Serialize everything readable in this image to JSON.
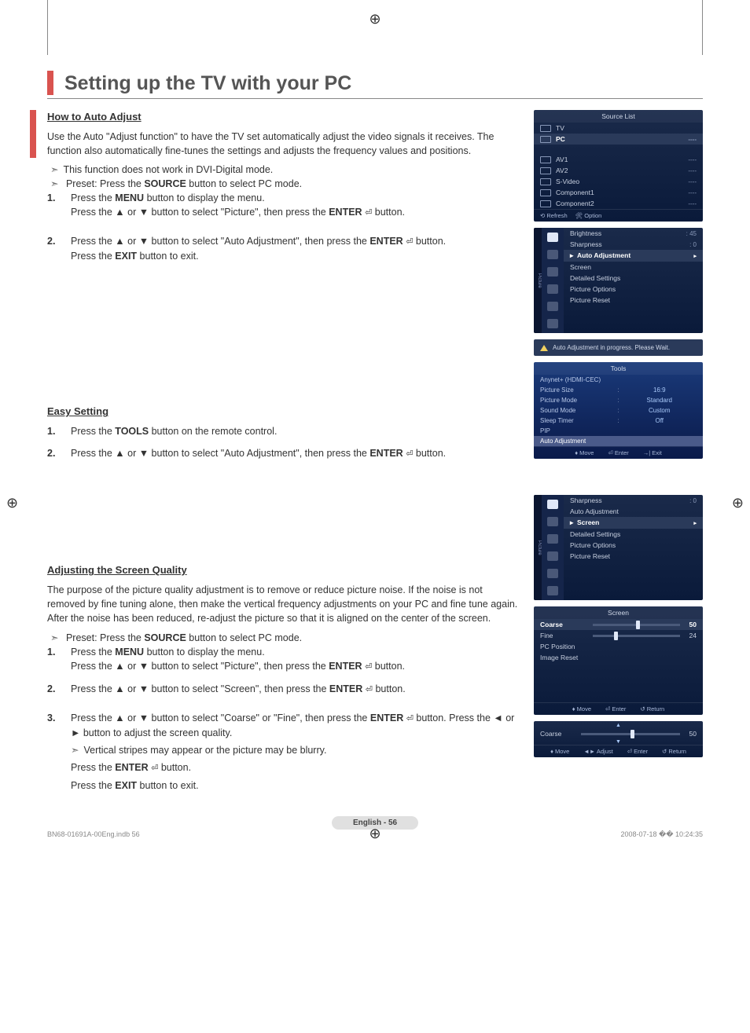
{
  "page": {
    "title": "Setting up the TV with your PC",
    "footer_badge": "English - 56",
    "doc_footer_left": "BN68-01691A-00Eng.indb   56",
    "doc_footer_right": "2008-07-18   �� 10:24:35"
  },
  "section1": {
    "heading": "How to Auto Adjust",
    "intro": "Use the Auto \"Adjust function\" to have the TV set automatically adjust the video signals it receives. The function also automatically fine-tunes the settings and adjusts the frequency values and positions.",
    "note1": "This function does not work in DVI-Digital mode.",
    "note2_pre": "Preset: Press the ",
    "note2_btn": "SOURCE",
    "note2_post": " button to select PC mode.",
    "step1_pre": "Press the ",
    "step1_btn": "MENU",
    "step1_post": " button to display the menu.",
    "step1b": "Press the ▲ or ▼ button to select \"Picture\", then press the ",
    "step1b_btn": "ENTER",
    "step1b_post": " button.",
    "step2": "Press the ▲ or ▼ button to select \"Auto Adjustment\", then press the ",
    "step2_btn": "ENTER",
    "step2_post": " button.",
    "step2_exit_pre": "Press the ",
    "step2_exit_btn": "EXIT",
    "step2_exit_post": " button to exit."
  },
  "section2": {
    "heading": "Easy Setting",
    "step1_pre": "Press the ",
    "step1_btn": "TOOLS",
    "step1_post": " button on the remote control.",
    "step2": "Press the ▲ or ▼ button to select \"Auto Adjustment\", then press the ",
    "step2_btn": "ENTER",
    "step2_post": " button."
  },
  "section3": {
    "heading": "Adjusting the Screen Quality",
    "intro": "The purpose of the picture quality adjustment is to remove or reduce picture noise. If the noise is not removed by fine tuning alone, then make the vertical frequency adjustments on your PC and fine tune again. After the noise has been reduced, re-adjust the picture so that it is aligned on the center of the screen.",
    "note1_pre": "Preset: Press the ",
    "note1_btn": "SOURCE",
    "note1_post": " button to select PC mode.",
    "step1_pre": "Press the ",
    "step1_btn": "MENU",
    "step1_post": " button to display the menu.",
    "step1b": "Press the ▲ or ▼ button to select \"Picture\", then press the ",
    "step1b_btn": "ENTER",
    "step1b_post": " button.",
    "step2": "Press the ▲ or ▼ button to select \"Screen\", then press the ",
    "step2_btn": "ENTER",
    "step2_post": " button.",
    "step3": "Press the ▲ or ▼ button to select \"Coarse\" or \"Fine\", then press the ",
    "step3_btn": "ENTER",
    "step3_post": " button. Press the ◄ or ► button to adjust the screen quality.",
    "step3_note": "Vertical stripes may appear or the picture may be blurry.",
    "step3_enter_pre": "Press the ",
    "step3_enter_btn": "ENTER",
    "step3_enter_post": " button.",
    "step3_exit_pre": "Press the ",
    "step3_exit_btn": "EXIT",
    "step3_exit_post": " button to exit."
  },
  "osd": {
    "source_list": {
      "title": "Source List",
      "items": [
        {
          "label": "TV",
          "value": ""
        },
        {
          "label": "PC",
          "value": "----",
          "selected": true
        },
        {
          "label": "AV1",
          "value": "----"
        },
        {
          "label": "AV2",
          "value": "----"
        },
        {
          "label": "S-Video",
          "value": "----"
        },
        {
          "label": "Component1",
          "value": "----"
        },
        {
          "label": "Component2",
          "value": "----"
        }
      ],
      "footer": [
        {
          "icon": "⟲",
          "label": "Refresh"
        },
        {
          "icon": "🛠",
          "label": "Option"
        }
      ]
    },
    "picture1": {
      "tab": "Picture",
      "top_rows": [
        {
          "label": "Brightness",
          "value": ": 45"
        },
        {
          "label": "Sharpness",
          "value": ": 0"
        }
      ],
      "selected": "Auto Adjustment",
      "rows": [
        "Screen",
        "Detailed Settings",
        "Picture Options",
        "Picture Reset"
      ]
    },
    "info_bar": "Auto Adjustment in progress. Please Wait.",
    "tools": {
      "title": "Tools",
      "top": "Anynet+ (HDMI-CEC)",
      "rows": [
        {
          "l": "Picture Size",
          "v": "16:9"
        },
        {
          "l": "Picture Mode",
          "v": "Standard"
        },
        {
          "l": "Sound Mode",
          "v": "Custom"
        },
        {
          "l": "Sleep Timer",
          "v": "Off"
        },
        {
          "l": "PIP",
          "v": ""
        }
      ],
      "hl": "Auto Adjustment",
      "footer": [
        {
          "i": "♦",
          "l": "Move"
        },
        {
          "i": "⏎",
          "l": "Enter"
        },
        {
          "i": "→|",
          "l": "Exit"
        }
      ]
    },
    "picture2": {
      "tab": "Picture",
      "top_rows": [
        {
          "label": "Sharpness",
          "value": ": 0"
        },
        {
          "label": "Auto Adjustment",
          "value": ""
        }
      ],
      "selected": "Screen",
      "rows": [
        "Detailed Settings",
        "Picture Options",
        "Picture Reset"
      ]
    },
    "screen_menu": {
      "title": "Screen",
      "rows": [
        {
          "l": "Coarse",
          "slider": 50,
          "v": "50",
          "hl": true
        },
        {
          "l": "Fine",
          "slider": 24,
          "v": "24"
        },
        {
          "l": "PC Position"
        },
        {
          "l": "Image Reset"
        }
      ],
      "footer": [
        {
          "i": "♦",
          "l": "Move"
        },
        {
          "i": "⏎",
          "l": "Enter"
        },
        {
          "i": "↺",
          "l": "Return"
        }
      ]
    },
    "coarse_bar": {
      "label": "Coarse",
      "slider": 50,
      "v": "50",
      "footer": [
        {
          "i": "♦",
          "l": "Move"
        },
        {
          "i": "◄►",
          "l": "Adjust"
        },
        {
          "i": "⏎",
          "l": "Enter"
        },
        {
          "i": "↺",
          "l": "Return"
        }
      ]
    }
  }
}
